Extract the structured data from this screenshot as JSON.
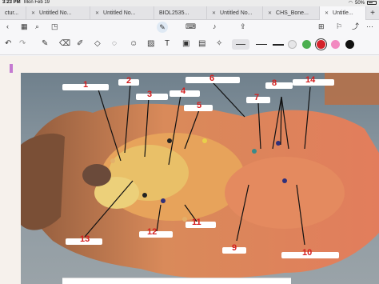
{
  "statusbar": {
    "time": "3:23 PM",
    "date": "Mon Feb 19",
    "battery": "50%"
  },
  "tabs": [
    {
      "label": "ctur..."
    },
    {
      "label": "Untitled No..."
    },
    {
      "label": "Untitled No..."
    },
    {
      "label": "BIOL2535..."
    },
    {
      "label": "Untitled No..."
    },
    {
      "label": "CHS_Bone..."
    },
    {
      "label": "Untitle..."
    }
  ],
  "toolbar": {
    "colors": [
      "#3a3a3a",
      "#cfd0d3",
      "#4caf50",
      "#d4222a",
      "#f28ac0",
      "#111111"
    ],
    "selected_color": "#d4222a"
  },
  "annotations": {
    "labels": [
      "1",
      "2",
      "3",
      "4",
      "5",
      "6",
      "7",
      "8",
      "14",
      "13",
      "12",
      "11",
      "9",
      "10"
    ]
  }
}
